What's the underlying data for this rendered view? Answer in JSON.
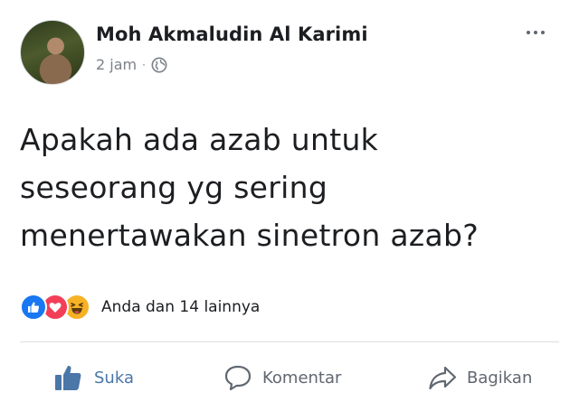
{
  "post": {
    "author": "Moh Akmaludin Al Karimi",
    "time": "2 jam",
    "separator": "·",
    "privacy_icon": "globe-icon",
    "text_lines": [
      "Apakah ada azab untuk",
      "seseorang yg sering",
      "menertawakan sinetron azab?"
    ]
  },
  "reactions": {
    "icons": [
      "like-icon",
      "love-icon",
      "haha-icon"
    ],
    "summary": "Anda dan 14 lainnya"
  },
  "actions": {
    "like_label": "Suka",
    "comment_label": "Komentar",
    "share_label": "Bagikan"
  },
  "colors": {
    "like_blue": "#1877f2",
    "love_red": "#f33e58",
    "haha_yellow": "#f7b125",
    "action_gray": "#606770"
  }
}
